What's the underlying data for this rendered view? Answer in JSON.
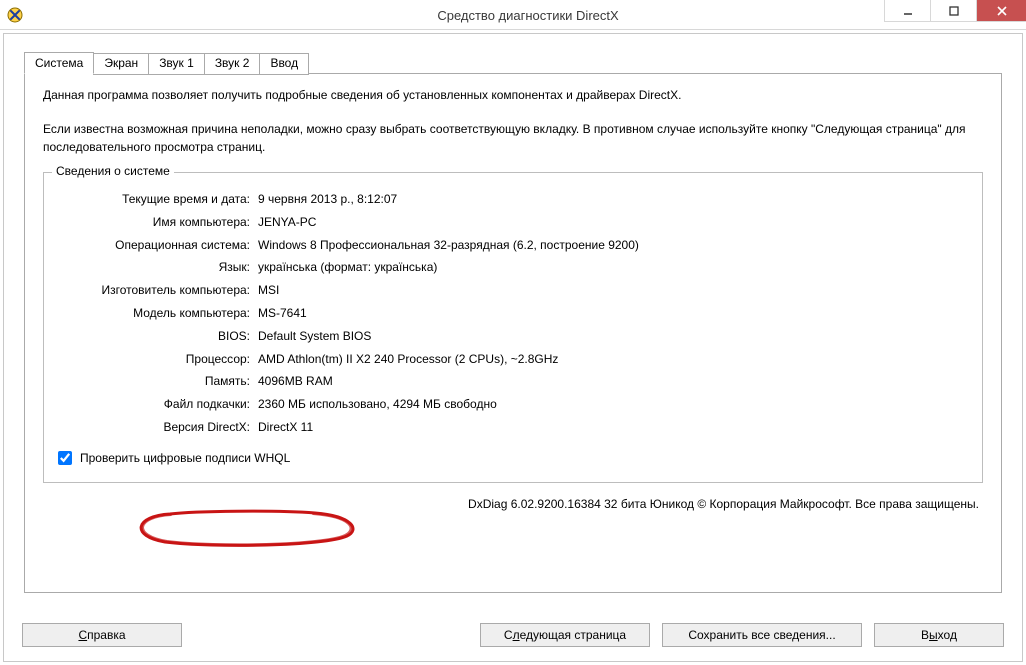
{
  "window": {
    "title": "Средство диагностики DirectX"
  },
  "tabs": [
    "Система",
    "Экран",
    "Звук 1",
    "Звук 2",
    "Ввод"
  ],
  "intro": {
    "p1": "Данная программа позволяет получить подробные сведения об установленных компонентах и драйверах DirectX.",
    "p2": "Если известна возможная причина неполадки, можно сразу выбрать соответствующую вкладку. В противном случае используйте кнопку \"Следующая страница\" для последовательного просмотра страниц."
  },
  "group": {
    "title": "Сведения о системе"
  },
  "rows": [
    {
      "label": "Текущие время и дата:",
      "value": "9 червня 2013 р., 8:12:07"
    },
    {
      "label": "Имя компьютера:",
      "value": "JENYA-PC"
    },
    {
      "label": "Операционная система:",
      "value": "Windows 8 Профессиональная 32-разрядная (6.2, построение 9200)"
    },
    {
      "label": "Язык:",
      "value": "українська (формат: українська)"
    },
    {
      "label": "Изготовитель компьютера:",
      "value": "MSI"
    },
    {
      "label": "Модель компьютера:",
      "value": "MS-7641"
    },
    {
      "label": "BIOS:",
      "value": "Default System BIOS"
    },
    {
      "label": "Процессор:",
      "value": "AMD Athlon(tm) II X2 240 Processor (2 CPUs), ~2.8GHz"
    },
    {
      "label": "Память:",
      "value": "4096MB RAM"
    },
    {
      "label": "Файл подкачки:",
      "value": "2360 МБ использовано, 4294 МБ свободно"
    },
    {
      "label": "Версия DirectX:",
      "value": "DirectX 11"
    }
  ],
  "whql": {
    "checked": true,
    "label": "Проверить цифровые подписи WHQL"
  },
  "copyright": "DxDiag 6.02.9200.16384 32 бита Юникод © Корпорация Майкрософт. Все права защищены.",
  "buttons": {
    "help": "Справка",
    "next": "Следующая страница",
    "save": "Сохранить все сведения...",
    "exit": "Выход"
  }
}
